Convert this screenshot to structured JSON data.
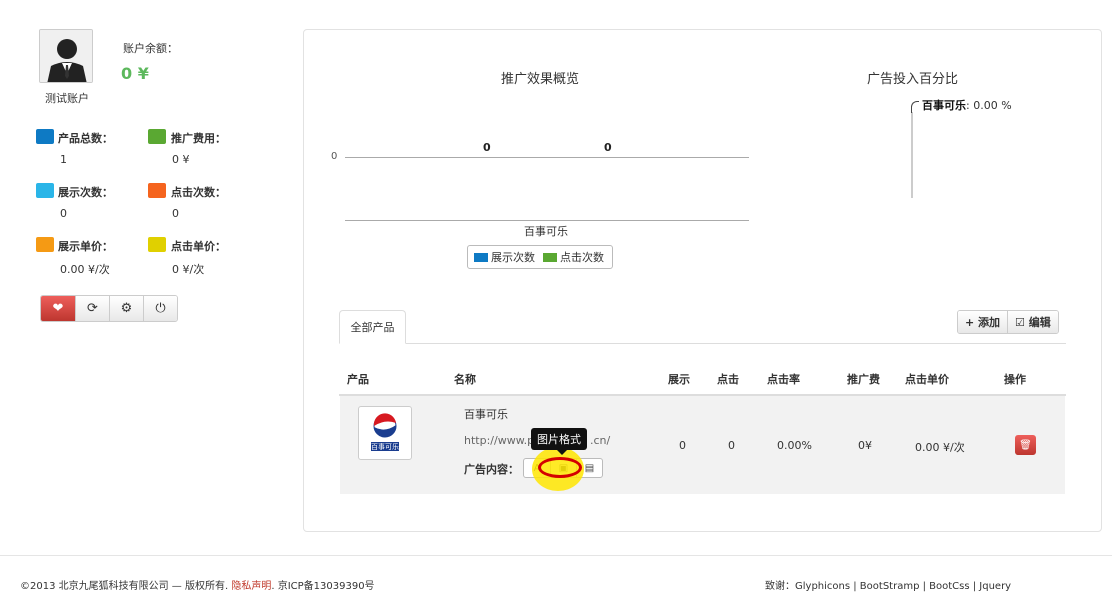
{
  "account": {
    "username": "测试账户",
    "balance_label": "账户余额：",
    "balance_value": "0 ¥"
  },
  "stats": [
    {
      "label": "产品总数：",
      "value": "1",
      "color": "#0e7ac4"
    },
    {
      "label": "推广费用：",
      "value": "0 ¥",
      "color": "#5aa832"
    },
    {
      "label": "展示次数：",
      "value": "0",
      "color": "#2ab5e8"
    },
    {
      "label": "点击次数：",
      "value": "0",
      "color": "#f5641e"
    },
    {
      "label": "展示单价：",
      "value": "0.00 ¥/次",
      "color": "#f59a14"
    },
    {
      "label": "点击单价：",
      "value": "0 ¥/次",
      "color": "#e0d000"
    }
  ],
  "toolbar": {
    "icons": [
      "heart-icon",
      "refresh-icon",
      "gear-icon",
      "power-icon"
    ]
  },
  "overview_chart": {
    "title": "推广效果概览",
    "zero_label": "0",
    "value_labels": [
      "0",
      "0"
    ],
    "category": "百事可乐",
    "legend": [
      {
        "label": "展示次数",
        "color": "#0e7ac4"
      },
      {
        "label": "点击次数",
        "color": "#5aa832"
      }
    ]
  },
  "pie_chart": {
    "title": "广告投入百分比",
    "slice_name": "百事可乐",
    "slice_value": ": 0.00 %"
  },
  "chart_data": [
    {
      "type": "bar",
      "title": "推广效果概览",
      "categories": [
        "百事可乐"
      ],
      "series": [
        {
          "name": "展示次数",
          "values": [
            0
          ]
        },
        {
          "name": "点击次数",
          "values": [
            0
          ]
        }
      ],
      "legend": "bottom"
    },
    {
      "type": "pie",
      "title": "广告投入百分比",
      "slices": [
        {
          "label": "百事可乐",
          "value": 0.0
        }
      ]
    }
  ],
  "tabs": {
    "active": "全部产品",
    "add_label": "+ 添加",
    "edit_label": "☑ 编辑"
  },
  "table": {
    "headers": [
      "产品",
      "名称",
      "展示",
      "点击",
      "点击率",
      "推广费",
      "点击单价",
      "操作"
    ],
    "row": {
      "logo_text": "百事可乐",
      "name": "百事可乐",
      "url": "http://www.p",
      "url_tail": ".cn/",
      "ad_content_label": "广告内容：",
      "tooltip": "图片格式",
      "impressions": "0",
      "clicks": "0",
      "ctr": "0.00%",
      "cost": "0¥",
      "cpc": "0.00 ¥/次"
    }
  },
  "footer": {
    "copyright": "©2013 北京九尾狐科技有限公司 — 版权所有. ",
    "privacy": "隐私声明",
    "icp": ". 京ICP备13039390号",
    "thanks": "致谢：Glyphicons | BootStramp | BootCss | Jquery"
  }
}
